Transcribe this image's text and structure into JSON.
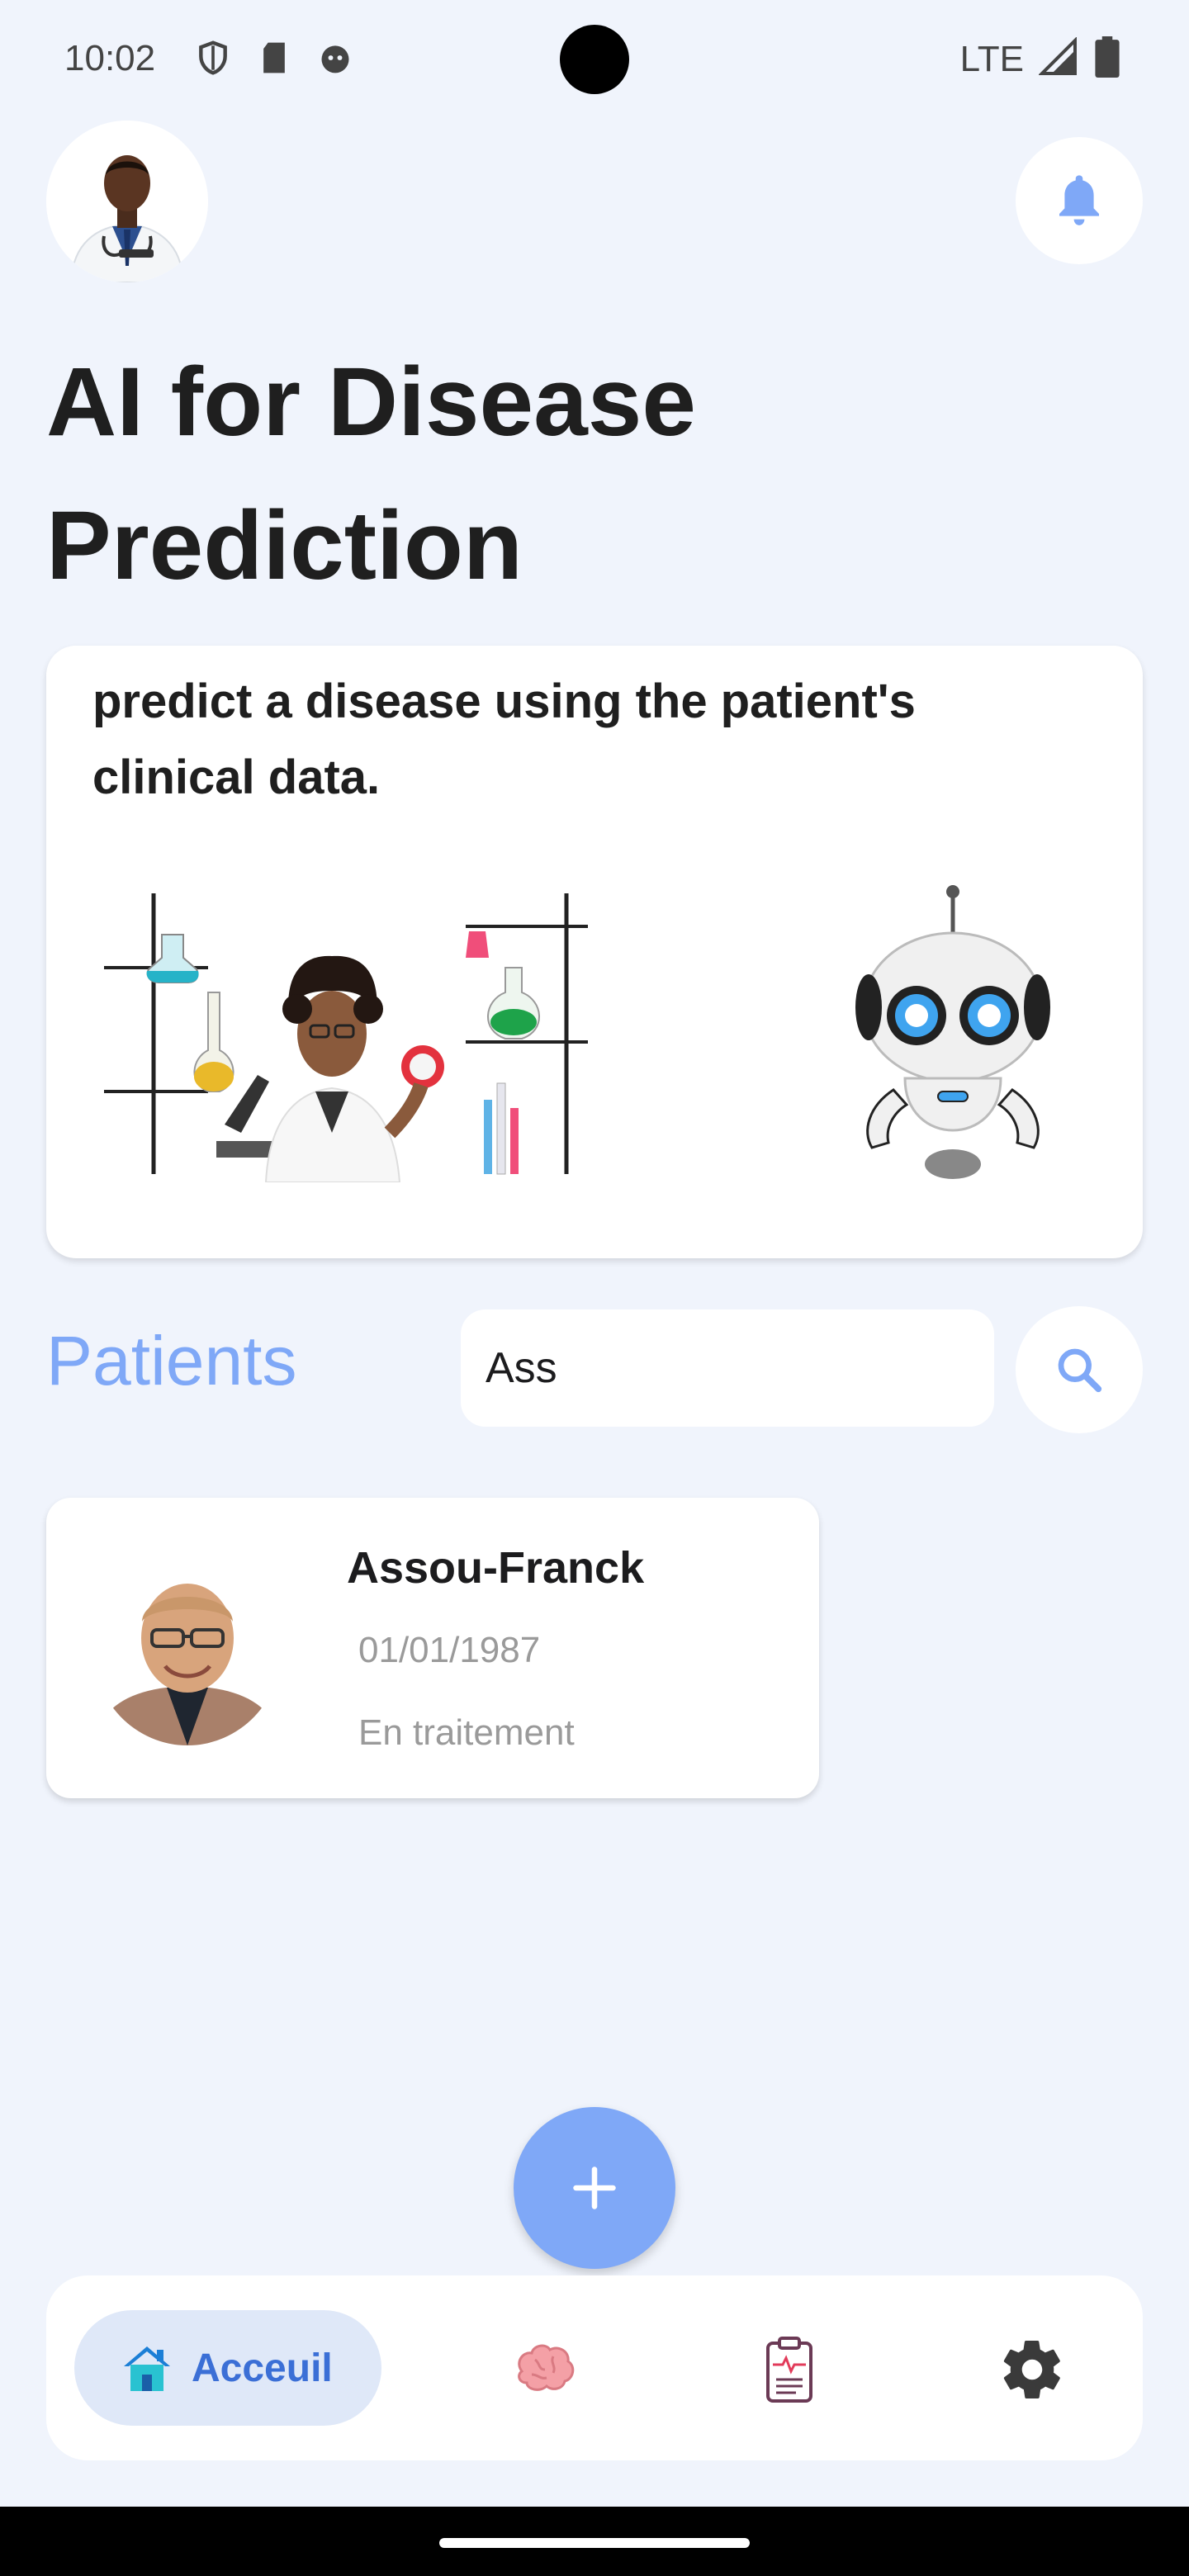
{
  "status_bar": {
    "time": "10:02",
    "network": "LTE"
  },
  "header": {
    "title": "AI for Disease Prediction"
  },
  "hero": {
    "text": "predict a disease using the patient's clinical data."
  },
  "patients": {
    "heading": "Patients",
    "search_value": "Ass",
    "list": [
      {
        "name": "Assou-Franck",
        "dob": "01/01/1987",
        "status": "En traitement"
      }
    ]
  },
  "bottom_nav": {
    "home_label": "Acceuil",
    "items": [
      "home-icon",
      "brain-icon",
      "clipboard-icon",
      "gear-icon"
    ]
  },
  "colors": {
    "accent": "#7fa8f7",
    "background": "#f0f4fc",
    "active_nav_bg": "#dfe8f8"
  }
}
